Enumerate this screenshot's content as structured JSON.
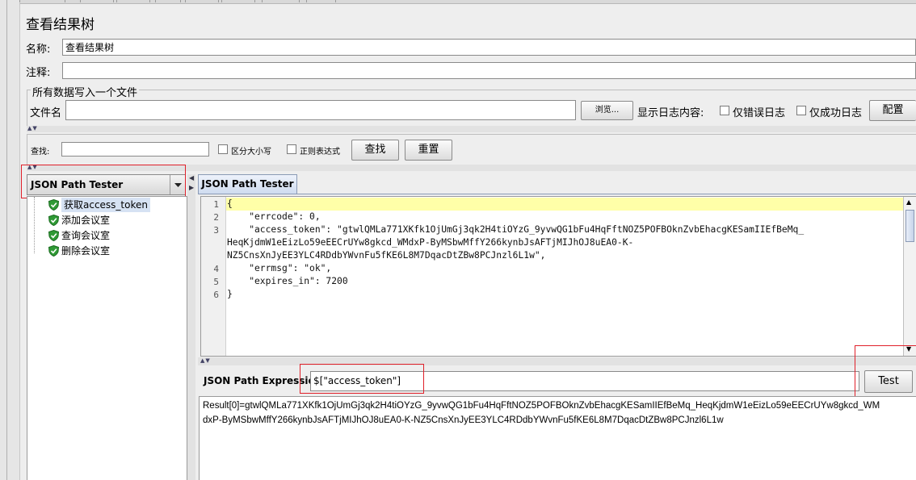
{
  "window_title": "查看结果树",
  "name_field": {
    "label": "名称:",
    "value": "查看结果树"
  },
  "comment_field": {
    "label": "注释:",
    "value": ""
  },
  "file_section": {
    "group_title": "所有数据写入一个文件",
    "filename_label": "文件名",
    "filename_value": "",
    "browse_label": "浏览...",
    "log_display_label": "显示日志内容:",
    "errors_only_label": "仅错误日志",
    "success_only_label": "仅成功日志",
    "configure_label": "配置"
  },
  "search": {
    "label": "查找:",
    "value": "",
    "case_sensitive_label": "区分大小写",
    "regex_label": "正则表达式",
    "find_label": "查找",
    "reset_label": "重置"
  },
  "renderer": {
    "selected": "JSON Path Tester"
  },
  "tree_items": [
    "获取access_token",
    "添加会议室",
    "查询会议室",
    "删除会议室"
  ],
  "tab": {
    "label": "JSON Path Tester"
  },
  "response": {
    "line_numbers": [
      "1",
      "2",
      "3",
      "4",
      "5",
      "6"
    ],
    "lines": [
      "{",
      "    \"errcode\": 0,",
      "    \"access_token\": \"gtwlQMLa771XKfk1OjUmGj3qk2H4tiOYzG_9yvwQG1bFu4HqFftNOZ5POFBOknZvbEhacgKESamIIEfBeMq_",
      "HeqKjdmW1eEizLo59eEECrUYw8gkcd_WMdxP-ByMSbwMffY266kynbJsAFTjMIJhOJ8uEA0-K-",
      "NZ5CnsXnJyEE3YLC4RDdbYWvnFu5fKE6L8M7DqacDtZBw8PCJnzl6L1w\",",
      "    \"errmsg\": \"ok\",",
      "    \"expires_in\": 7200",
      "}"
    ]
  },
  "expression": {
    "label": "JSON Path Expression",
    "value": "$[\"access_token\"]",
    "test_label": "Test"
  },
  "result": {
    "line1": "Result[0]=gtwlQMLa771XKfk1OjUmGj3qk2H4tiOYzG_9yvwQG1bFu4HqFftNOZ5POFBOknZvbEhacgKESamIIEfBeMq_HeqKjdmW1eEizLo59eEECrUYw8gkcd_WM",
    "line2": "dxP-ByMSbwMffY266kynbJsAFTjMIJhOJ8uEA0-K-NZ5CnsXnJyEE3YLC4RDdbYWvnFu5fKE6L8M7DqacDtZBw8PCJnzl6L1w"
  },
  "colors": {
    "highlight_line": "#ffffa8",
    "annotation_red": "#e0202a",
    "tab_blue": "#cfdcef",
    "tree_selection": "#d6e2f3"
  }
}
